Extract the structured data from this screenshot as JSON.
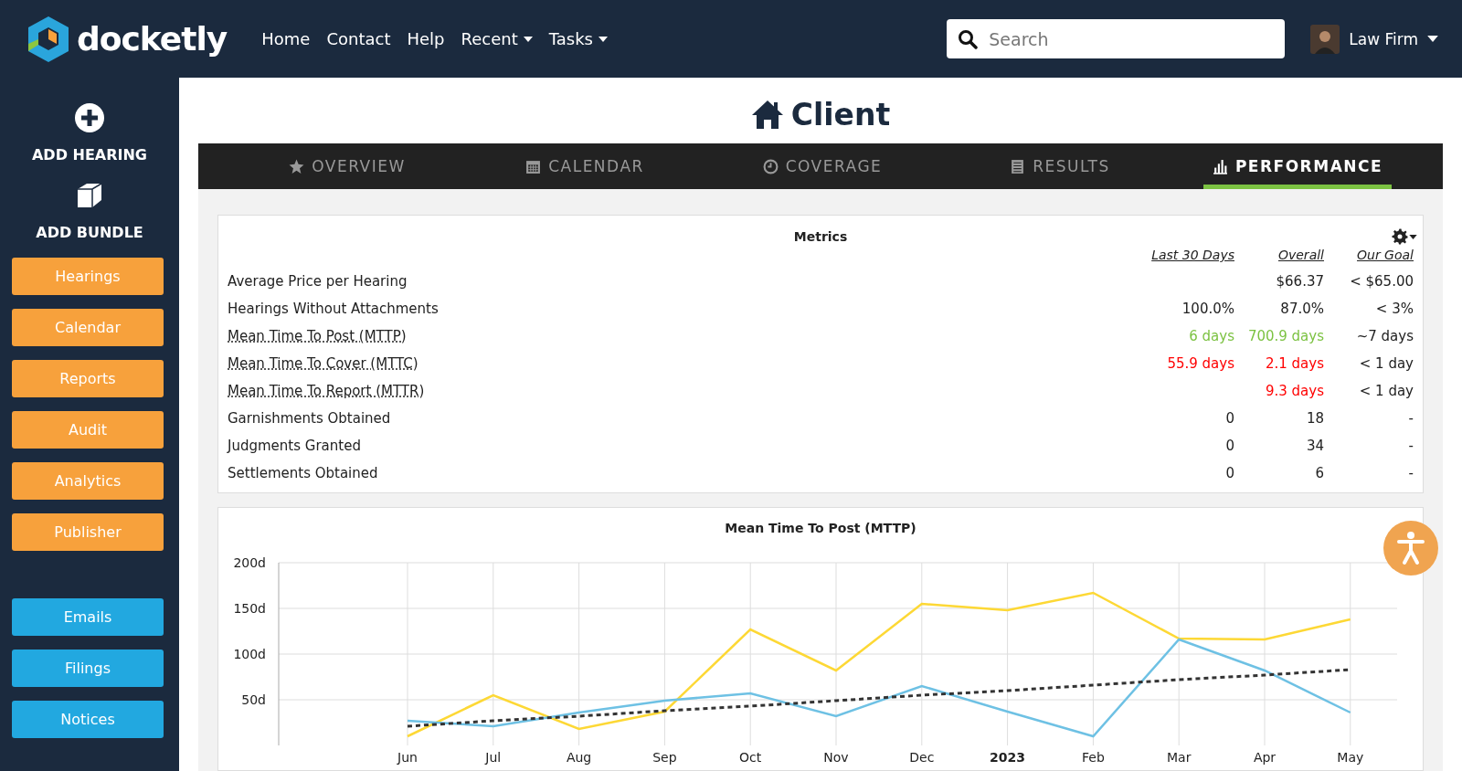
{
  "header": {
    "brand": "docketly",
    "nav": [
      {
        "label": "Home",
        "dropdown": false
      },
      {
        "label": "Contact",
        "dropdown": false
      },
      {
        "label": "Help",
        "dropdown": false
      },
      {
        "label": "Recent",
        "dropdown": true
      },
      {
        "label": "Tasks",
        "dropdown": true
      }
    ],
    "search": {
      "placeholder": "Search"
    },
    "user": {
      "name": "Law Firm"
    }
  },
  "sidebar": {
    "actions": [
      {
        "label": "ADD HEARING"
      },
      {
        "label": "ADD BUNDLE"
      }
    ],
    "groups": [
      [
        {
          "label": "Hearings",
          "color": "#f7a13c"
        },
        {
          "label": "Calendar",
          "color": "#f7a13c"
        },
        {
          "label": "Reports",
          "color": "#f7a13c"
        },
        {
          "label": "Audit",
          "color": "#f7a13c"
        },
        {
          "label": "Analytics",
          "color": "#f7a13c"
        },
        {
          "label": "Publisher",
          "color": "#f7a13c"
        }
      ],
      [
        {
          "label": "Emails",
          "color": "#22a8e0"
        },
        {
          "label": "Filings",
          "color": "#22a8e0"
        },
        {
          "label": "Notices",
          "color": "#22a8e0"
        }
      ]
    ]
  },
  "page": {
    "title": "Client"
  },
  "tabs": [
    {
      "label": "OVERVIEW",
      "selected": false
    },
    {
      "label": "CALENDAR",
      "selected": false
    },
    {
      "label": "COVERAGE",
      "selected": false
    },
    {
      "label": "RESULTS",
      "selected": false
    },
    {
      "label": "PERFORMANCE",
      "selected": true
    }
  ],
  "metrics": {
    "title": "Metrics",
    "columns": [
      "Last 30 Days",
      "Overall",
      "Our Goal"
    ],
    "rows": [
      {
        "label": "Average Price per Hearing",
        "linked": false,
        "overall": {
          "text": "$66.37"
        },
        "our_goal": {
          "text": "< $65.00"
        }
      },
      {
        "label": "Hearings Without Attachments",
        "linked": false,
        "last_30_days": {
          "text": "100.0%"
        },
        "overall": {
          "text": "87.0%"
        },
        "our_goal": {
          "text": "< 3%"
        }
      },
      {
        "label": "Mean Time To Post (MTTP)",
        "linked": true,
        "last_30_days": {
          "text": "6 days",
          "color": "#7cc242"
        },
        "overall": {
          "text": "700.9 days",
          "color": "#7cc242"
        },
        "our_goal": {
          "text": "~7 days"
        }
      },
      {
        "label": "Mean Time To Cover (MTTC)",
        "linked": true,
        "last_30_days": {
          "text": "55.9 days",
          "color": "#ff0000"
        },
        "overall": {
          "text": "2.1 days",
          "color": "#ff0000"
        },
        "our_goal": {
          "text": "< 1 day"
        }
      },
      {
        "label": "Mean Time To Report (MTTR)",
        "linked": true,
        "overall": {
          "text": "9.3 days",
          "color": "#ff0000"
        },
        "our_goal": {
          "text": "< 1 day"
        }
      },
      {
        "label": "Garnishments Obtained",
        "linked": false,
        "last_30_days": {
          "text": "0"
        },
        "overall": {
          "text": "18"
        },
        "our_goal": {
          "text": "-"
        }
      },
      {
        "label": "Judgments Granted",
        "linked": false,
        "last_30_days": {
          "text": "0"
        },
        "overall": {
          "text": "34"
        },
        "our_goal": {
          "text": "-"
        }
      },
      {
        "label": "Settlements Obtained",
        "linked": false,
        "last_30_days": {
          "text": "0"
        },
        "overall": {
          "text": "6"
        },
        "our_goal": {
          "text": "-"
        }
      }
    ]
  },
  "chart": {
    "chart_data": {
      "type": "line",
      "title": "Mean Time To Post (MTTP)",
      "grid": true,
      "categories": [
        "Jun",
        "Jul",
        "Aug",
        "Sep",
        "Oct",
        "Nov",
        "Dec",
        "2023",
        "Feb",
        "Mar",
        "Apr",
        "May"
      ],
      "ylim": [
        0,
        200
      ],
      "yticks": [
        {
          "value": 50,
          "label": "50d"
        },
        {
          "value": 100,
          "label": "100d"
        },
        {
          "value": 150,
          "label": "150d"
        },
        {
          "value": 200,
          "label": "200d"
        }
      ],
      "series": [
        {
          "color": "#fdd835",
          "values": [
            10,
            55,
            18,
            37,
            127,
            82,
            155,
            148,
            167,
            117,
            116,
            138
          ],
          "line_style": "solid"
        },
        {
          "color": "#6ec1e4",
          "values": [
            27,
            21,
            36,
            49,
            57,
            32,
            65,
            37,
            10,
            116,
            82,
            36
          ],
          "line_style": "solid"
        },
        {
          "color": "#333333",
          "values": [
            21,
            27,
            32,
            38,
            43,
            49,
            55,
            60,
            66,
            72,
            77,
            83
          ],
          "line_style": "dashed"
        }
      ]
    }
  }
}
